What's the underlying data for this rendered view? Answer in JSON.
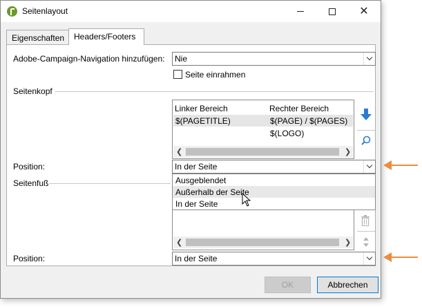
{
  "window": {
    "title": "Seitenlayout",
    "minimize": "—",
    "maximize": "☐",
    "close": "✕"
  },
  "tabs": [
    {
      "label": "Eigenschaften"
    },
    {
      "label": "Headers/Footers"
    }
  ],
  "nav": {
    "label": "Adobe-Campaign-Navigation hinzufügen:",
    "value": "Nie"
  },
  "frame_checkbox": {
    "label": "Seite einrahmen",
    "checked": false
  },
  "header": {
    "group_label": "Seitenkopf",
    "columns": [
      "Linker Bereich",
      "Rechter Bereich"
    ],
    "rows": [
      {
        "left": "$(PAGETITLE)",
        "right": "$(PAGE) / $(PAGES)"
      },
      {
        "left": "",
        "right": "$(LOGO)"
      }
    ],
    "position_label": "Position:",
    "position_value": "In der Seite"
  },
  "dropdown": {
    "options": [
      "Ausgeblendet",
      "Außerhalb der Seite",
      "In der Seite"
    ],
    "hovered_index": 1
  },
  "footer": {
    "group_label": "Seitenfuß",
    "position_label": "Position:",
    "position_value": "In der Seite"
  },
  "buttons": {
    "ok": "OK",
    "cancel": "Abbrechen"
  },
  "colors": {
    "annotation_arrow": "#f08a3c",
    "move_down_icon": "#2b7cd3",
    "app_icon": "#6b9a2e"
  },
  "icons": [
    "app-logo-icon",
    "move-down-icon",
    "zoom-icon",
    "delete-icon",
    "move-updown-icon",
    "mouse-cursor-icon"
  ]
}
